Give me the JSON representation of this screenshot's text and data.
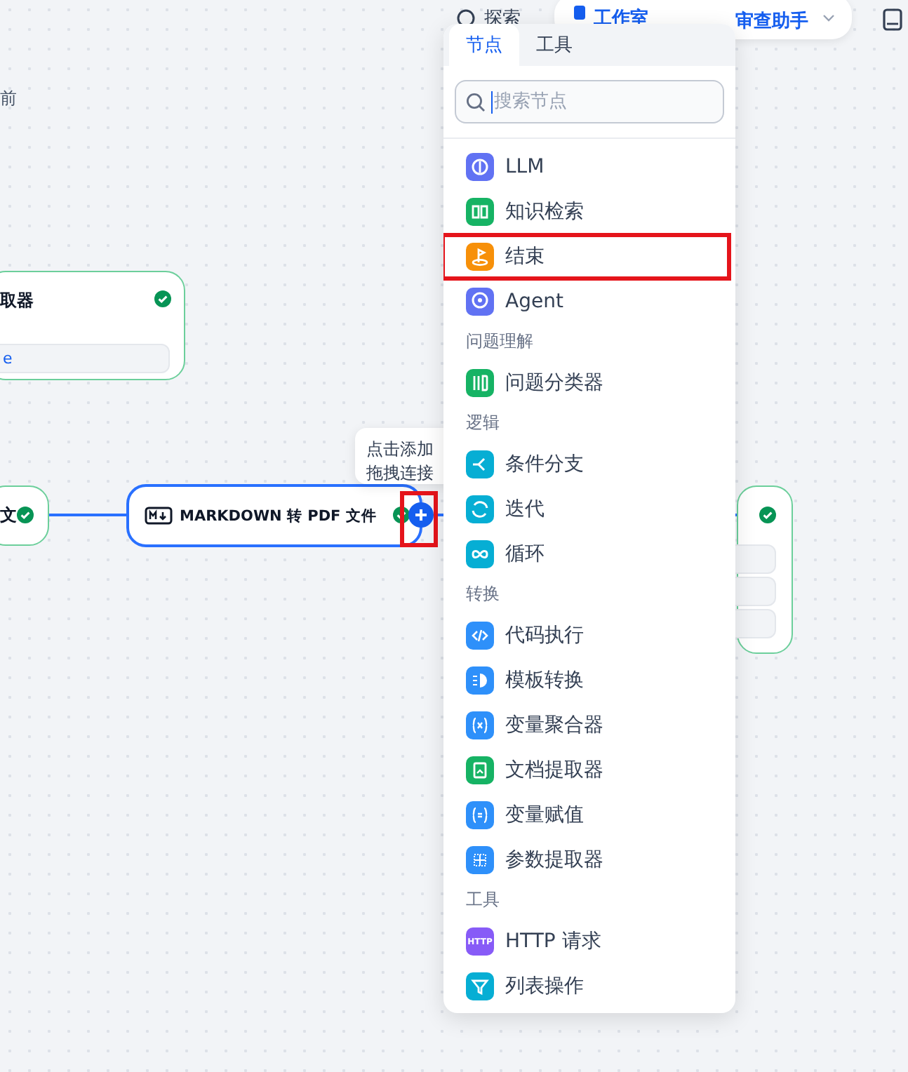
{
  "top_bar": {
    "explore": "探索",
    "studio": "工作室",
    "app_name": "审查助手"
  },
  "canvas": {
    "saved_note": "前",
    "nodes": [
      {
        "title": "取器",
        "selected": false,
        "fields": [
          "e"
        ]
      },
      {
        "title": "文",
        "selected": false
      },
      {
        "title": "MARKDOWN 转 PDF 文件",
        "selected": true
      },
      {
        "selected": false
      }
    ],
    "tooltip": [
      "点击添加",
      "拖拽连接"
    ],
    "add_button": {
      "highlighted": true
    }
  },
  "node_menu": {
    "tabs": [
      {
        "label": "节点",
        "selected": true
      },
      {
        "label": "工具",
        "selected": false
      }
    ],
    "search": {
      "placeholder": "搜索节点",
      "focused": true
    },
    "groups": [
      {
        "items": [
          {
            "label": "LLM",
            "color": "#6172f3",
            "highlighted": false
          },
          {
            "label": "知识检索",
            "color": "#16b364",
            "highlighted": false
          },
          {
            "label": "结束",
            "color": "#f79009",
            "highlighted": true
          },
          {
            "label": "Agent",
            "color": "#6172f3",
            "highlighted": false
          }
        ]
      },
      {
        "heading": "问题理解",
        "items": [
          {
            "label": "问题分类器",
            "color": "#16b364",
            "highlighted": false
          }
        ]
      },
      {
        "heading": "逻辑",
        "items": [
          {
            "label": "条件分支",
            "color": "#06aed4",
            "highlighted": false
          },
          {
            "label": "迭代",
            "color": "#06aed4",
            "highlighted": false
          },
          {
            "label": "循环",
            "color": "#06aed4",
            "highlighted": false
          }
        ]
      },
      {
        "heading": "转换",
        "items": [
          {
            "label": "代码执行",
            "color": "#2e90fa",
            "highlighted": false
          },
          {
            "label": "模板转换",
            "color": "#2e90fa",
            "highlighted": false
          },
          {
            "label": "变量聚合器",
            "color": "#2e90fa",
            "highlighted": false
          },
          {
            "label": "文档提取器",
            "color": "#16b364",
            "highlighted": false
          },
          {
            "label": "变量赋值",
            "color": "#2e90fa",
            "highlighted": false
          },
          {
            "label": "参数提取器",
            "color": "#2e90fa",
            "highlighted": false
          }
        ]
      },
      {
        "heading": "工具",
        "items": [
          {
            "label": "HTTP 请求",
            "color": "#875bf7",
            "highlighted": false,
            "icon_text": "HTTP"
          },
          {
            "label": "列表操作",
            "color": "#06aed4",
            "highlighted": false
          }
        ]
      }
    ]
  }
}
